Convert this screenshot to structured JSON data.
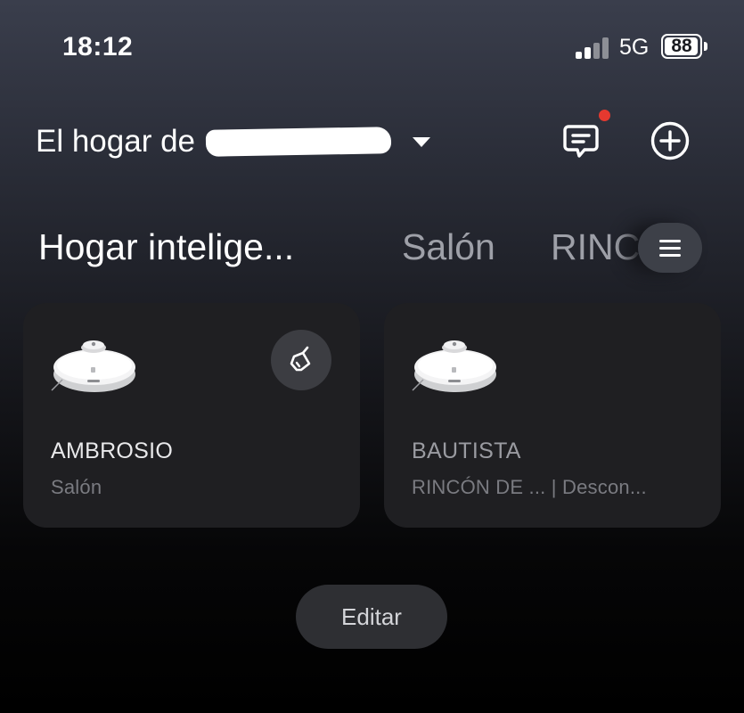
{
  "status_bar": {
    "time": "18:12",
    "network": "5G",
    "battery": "88",
    "battery_level_fraction": 0.88,
    "signal_bars_active": 2,
    "signal_bars_total": 4
  },
  "header": {
    "home_title": "El hogar de",
    "has_unread_messages": true,
    "notification_dot_color": "#e5392f"
  },
  "tabs": {
    "active": "Hogar intelige...",
    "items": [
      "Salón",
      "RINC"
    ]
  },
  "devices": [
    {
      "name": "AMBROSIO",
      "subtitle": "Salón"
    },
    {
      "name": "BAUTISTA",
      "subtitle": "RINCÓN DE ... | Descon..."
    }
  ],
  "edit_label": "Editar",
  "colors": {
    "card_background": "#1f1f22",
    "button_background": "#2e2f33",
    "accent_dot": "#e5392f"
  }
}
